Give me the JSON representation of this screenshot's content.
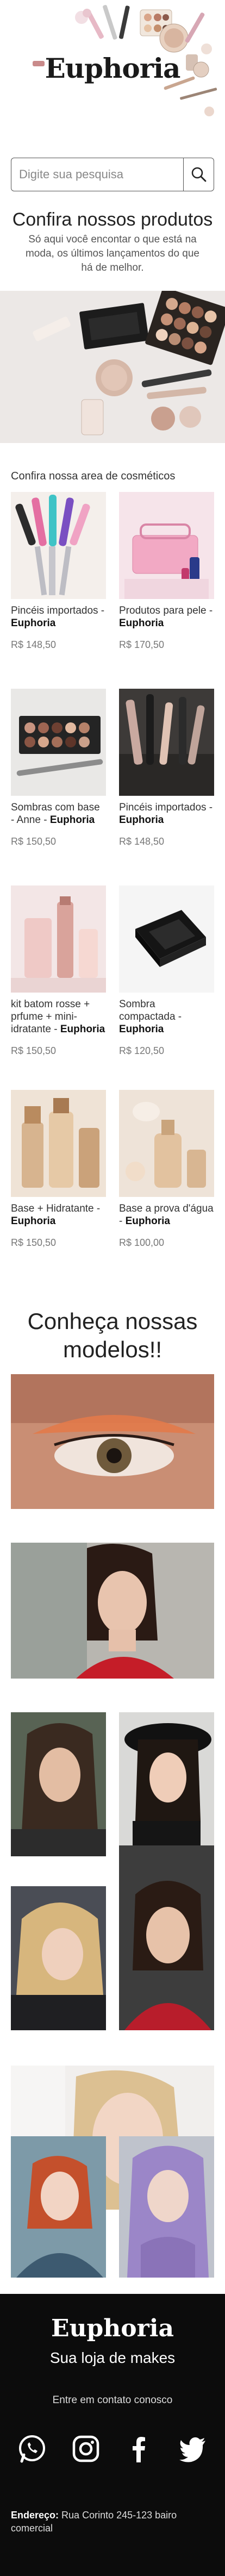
{
  "brand": {
    "name": "Euphoria"
  },
  "search": {
    "placeholder": "Digite sua pesquisa"
  },
  "intro": {
    "title": "Confira nossos produtos",
    "text": "Só aqui você encontar o que está na moda, os últimos lançamentos do que há de melhor."
  },
  "catalog": {
    "title": "Confira nossa area de cosméticos",
    "items": [
      {
        "name": "Pincéis importados - ",
        "brand": "Euphoria",
        "price": "R$ 148,50"
      },
      {
        "name": "Produtos para pele - ",
        "brand": "Euphoria",
        "price": "R$ 170,50"
      },
      {
        "name": "Sombras com base - Anne - ",
        "brand": "Euphoria",
        "price": "R$ 150,50"
      },
      {
        "name": "Pincéis importados - ",
        "brand": "Euphoria",
        "price": "R$ 148,50"
      },
      {
        "name": "kit batom rosse + prfume + mini-idratante - ",
        "brand": "Euphoria",
        "price": "R$ 150,50"
      },
      {
        "name": "Sombra compactada - ",
        "brand": "Euphoria",
        "price": "R$ 120,50"
      },
      {
        "name": "Base + Hidratante - ",
        "brand": "Euphoria",
        "price": "R$ 150,50"
      },
      {
        "name": "Base a prova d'água - ",
        "brand": "Euphoria",
        "price": "R$ 100,00"
      }
    ]
  },
  "models": {
    "title": "Conheça nossas modelos!!"
  },
  "footer": {
    "brand": "Euphoria",
    "tagline": "Sua loja de makes",
    "contact": "Entre em contato conosco",
    "address_label": "Endereço:",
    "address": "Rua Corinto 245-123 bairo comercial"
  },
  "colors": {
    "footer_bg": "#0c0c0c",
    "accent": "#111111"
  }
}
